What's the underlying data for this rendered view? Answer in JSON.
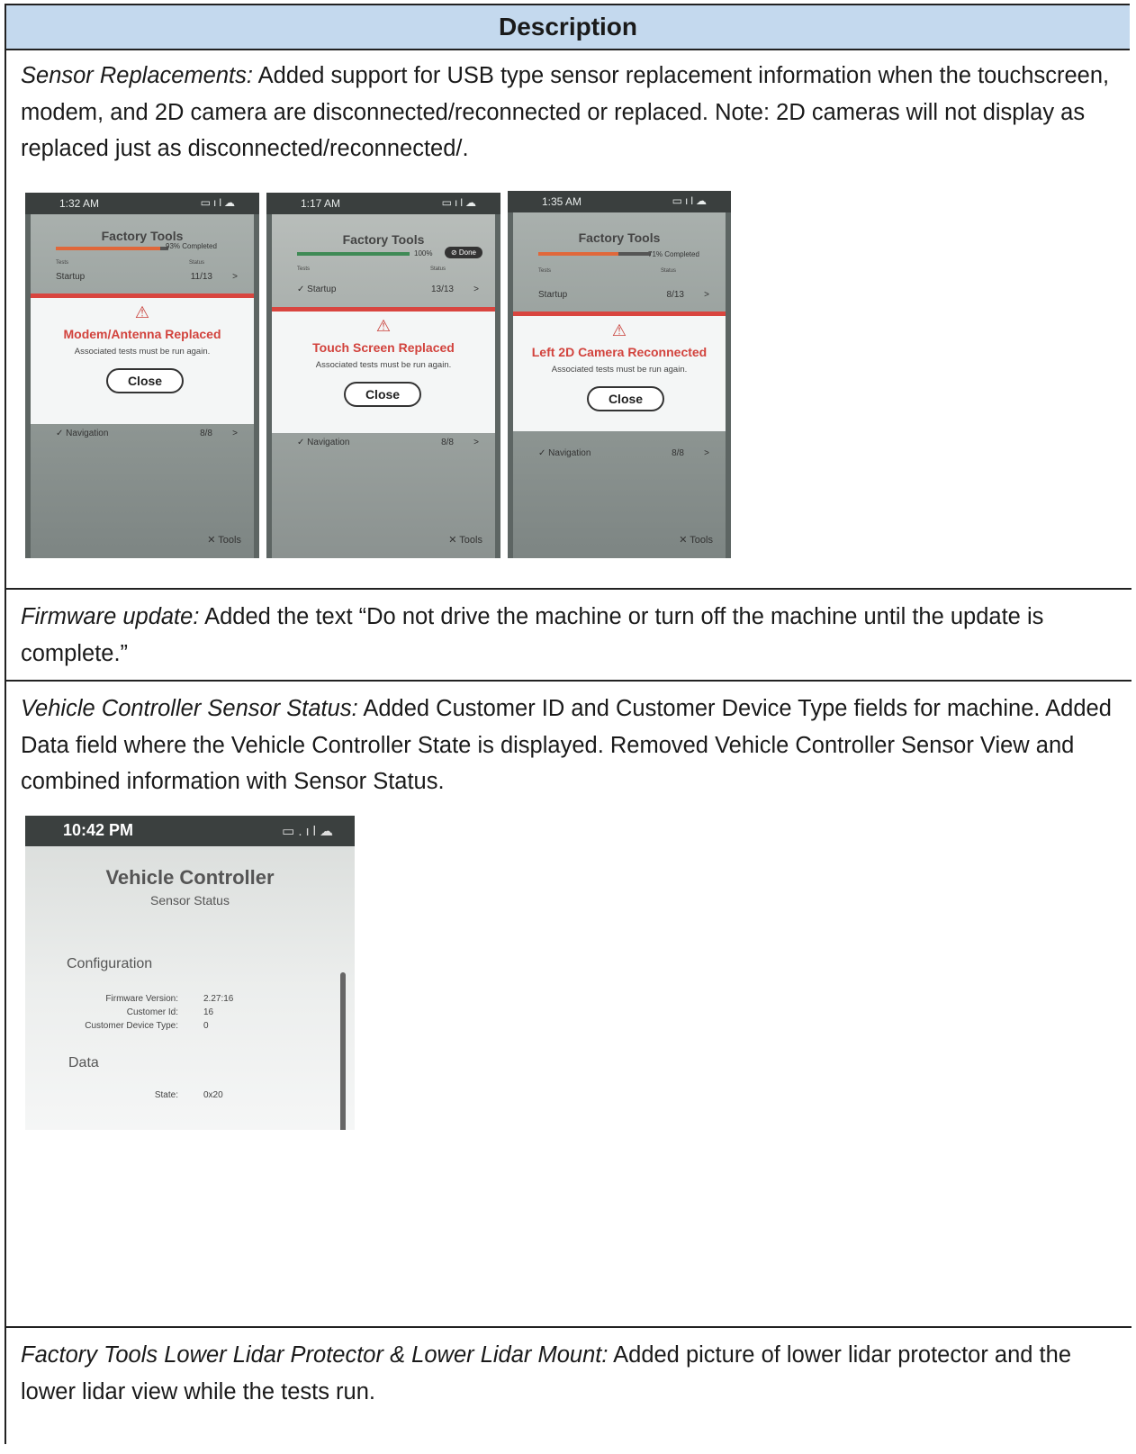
{
  "header": {
    "title": "Description"
  },
  "rows": [
    {
      "term": "Sensor Replacements:",
      "text": " Added support for USB type sensor replacement information when the touchscreen, modem, and 2D camera are disconnected/reconnected or replaced. Note: 2D cameras will not display as replaced just as disconnected/reconnected/."
    },
    {
      "term": "Firmware update:",
      "text": " Added the text “Do not drive the machine or turn off the machine until the update is complete.”"
    },
    {
      "term": "Vehicle Controller Sensor Status:",
      "text": " Added Customer ID and Customer Device Type fields for machine. Added Data field where the Vehicle Controller State is displayed. Removed Vehicle Controller Sensor View and combined information with Sensor Status."
    },
    {
      "term": "Factory Tools Lower Lidar Protector & Lower Lidar Mount:",
      "text": " Added picture of lower lidar protector and the lower lidar view while the tests run."
    }
  ],
  "phones": [
    {
      "time": "1:32 AM",
      "title": "Factory Tools",
      "pct": "93% Completed",
      "progress": 0.93,
      "bar_color": "#e0673a",
      "col_tests": "Tests",
      "col_status": "Status",
      "row1_label": "Startup",
      "row1_status": "11/13",
      "row1_chev": ">",
      "modal_title": "Modem/Antenna Replaced",
      "modal_sub": "Associated tests must be run again.",
      "close": "Close",
      "row2_label": "✓  Navigation",
      "row2_status": "8/8",
      "row2_chev": ">",
      "tools": "✕ Tools"
    },
    {
      "time": "1:17 AM",
      "title": "Factory Tools",
      "pct": "100%",
      "progress": 1.0,
      "bar_color": "#3f8a55",
      "done": "⊘ Done",
      "col_tests": "Tests",
      "col_status": "Status",
      "row1_label": "✓  Startup",
      "row1_status": "13/13",
      "row1_chev": ">",
      "modal_title": "Touch Screen Replaced",
      "modal_sub": "Associated tests must be run again.",
      "close": "Close",
      "row2_label": "✓  Navigation",
      "row2_status": "8/8",
      "row2_chev": ">",
      "tools": "✕ Tools"
    },
    {
      "time": "1:35 AM",
      "title": "Factory Tools",
      "pct": "71% Completed",
      "progress": 0.71,
      "bar_color": "#e0673a",
      "col_tests": "Tests",
      "col_status": "Status",
      "row1_label": "Startup",
      "row1_status": "8/13",
      "row1_chev": ">",
      "modal_title": "Left 2D Camera Reconnected",
      "modal_sub": "Associated tests must be run again.",
      "close": "Close",
      "row2_label": "✓  Navigation",
      "row2_status": "8/8",
      "row2_chev": ">",
      "tools": "✕ Tools"
    }
  ],
  "vc": {
    "time": "10:42 PM",
    "title": "Vehicle Controller",
    "subtitle": "Sensor Status",
    "config_heading": "Configuration",
    "fw_label": "Firmware Version:",
    "fw_value": "2.27:16",
    "cid_label": "Customer Id:",
    "cid_value": "16",
    "cdt_label": "Customer Device Type:",
    "cdt_value": "0",
    "data_heading": "Data",
    "state_label": "State:",
    "state_value": "0x20"
  },
  "icons": {
    "battery": "battery-icon",
    "signal": "signal-icon",
    "cloud": "cloud-icon",
    "warning": "warning-icon"
  }
}
